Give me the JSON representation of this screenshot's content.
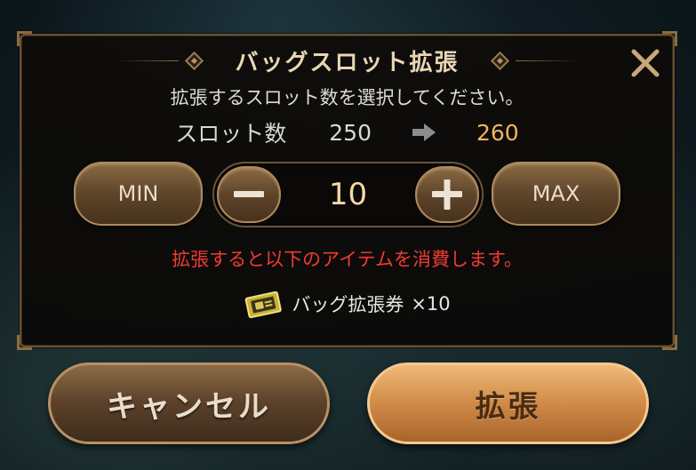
{
  "dialog": {
    "title": "バッグスロット拡張",
    "subtitle": "拡張するスロット数を選択してください。",
    "slot_label": "スロット数",
    "slot_current": "250",
    "slot_new": "260",
    "min_label": "MIN",
    "max_label": "MAX",
    "quantity": "10",
    "warning": "拡張すると以下のアイテムを消費します。",
    "item_name": "バッグ拡張券",
    "item_count": "×10"
  },
  "buttons": {
    "cancel_label": "キャンセル",
    "confirm_label": "拡張"
  },
  "colors": {
    "accent_gold": "#f6b25a",
    "warning_red": "#f03a32",
    "title_cream": "#e9d6b2",
    "confirm_orange": "#d48f4c"
  },
  "icons": [
    "close-icon",
    "arrow-right-icon",
    "minus-icon",
    "plus-icon",
    "bag-ticket-icon"
  ]
}
